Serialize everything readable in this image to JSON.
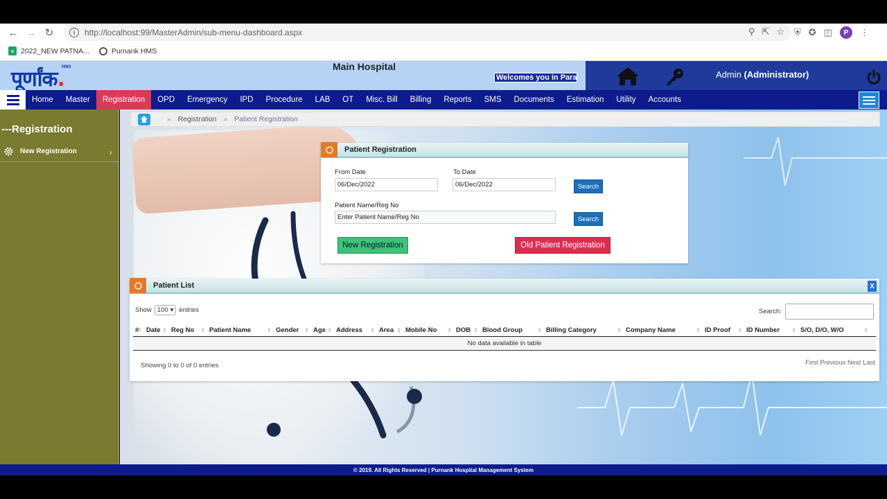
{
  "browser": {
    "url": "http://localhost:99/MasterAdmin/sub-menu-dashboard.aspx",
    "bookmarks": [
      "2022_NEW PATNA...",
      "Purnank HMS"
    ],
    "profile_initial": "P"
  },
  "header": {
    "logo_text": "पूर्णांक",
    "logo_dot": ".",
    "logo_sup": "HMS",
    "hospital_name": "Main Hospital",
    "welcome": "Welcomes you in Para",
    "admin_name": "Admin",
    "admin_role": "(Administrator)"
  },
  "nav": {
    "items": [
      "Home",
      "Master",
      "Registration",
      "OPD",
      "Emergency",
      "IPD",
      "Procedure",
      "LAB",
      "OT",
      "Misc. Bill",
      "Billing",
      "Reports",
      "SMS",
      "Documents",
      "Estimation",
      "Utility",
      "Accounts"
    ],
    "active": "Registration"
  },
  "sidebar": {
    "title": "---Registration",
    "items": [
      {
        "label": "New Registration"
      }
    ]
  },
  "breadcrumb": {
    "items": [
      "Registration",
      "Patient Registration"
    ]
  },
  "registration_panel": {
    "title": "Patient Registration",
    "from_date_label": "From Date",
    "from_date_value": "06/Dec/2022",
    "to_date_label": "To Date",
    "to_date_value": "06/Dec/2022",
    "search_label": "Search",
    "patient_label": "Patient Name/Reg No",
    "patient_placeholder": "Enter Patient Name/Reg No",
    "new_registration_label": "New Registration",
    "old_registration_label": "Old Patient Registration"
  },
  "patient_list": {
    "title": "Patient List",
    "close_label": "X",
    "show_label": "Show",
    "entries_value": "100",
    "entries_label": "entries",
    "search_label": "Search:",
    "columns": [
      "#",
      "Date",
      "Reg No",
      "Patient Name",
      "Gender",
      "Age",
      "Address",
      "Area",
      "Mobile No",
      "DOB",
      "Blood Group",
      "Billing Category",
      "Company Name",
      "ID Proof",
      "ID Number",
      "S/O, D/O, W/O"
    ],
    "empty_message": "No data available in table",
    "info": "Showing 0 to 0 of 0 entries",
    "pagination": "First Previous Next Last"
  },
  "footer": {
    "text": "© 2019. All Rights Reserved | Purnank Hospital Management System"
  },
  "colors": {
    "navbar": "#0d1b8c",
    "active_nav": "#d93a55",
    "sidebar": "#7a7a30",
    "header_light": "#b6d3f5",
    "header_dark": "#1f3a9a",
    "search_button": "#1d6fb8",
    "new_button": "#3ec27a",
    "old_button": "#dc2f50"
  },
  "icons": [
    "back-icon",
    "forward-icon",
    "reload-icon",
    "info-icon",
    "home-icon",
    "key-icon",
    "power-icon",
    "gear-icon",
    "chevron-right-icon",
    "menu-icon"
  ]
}
